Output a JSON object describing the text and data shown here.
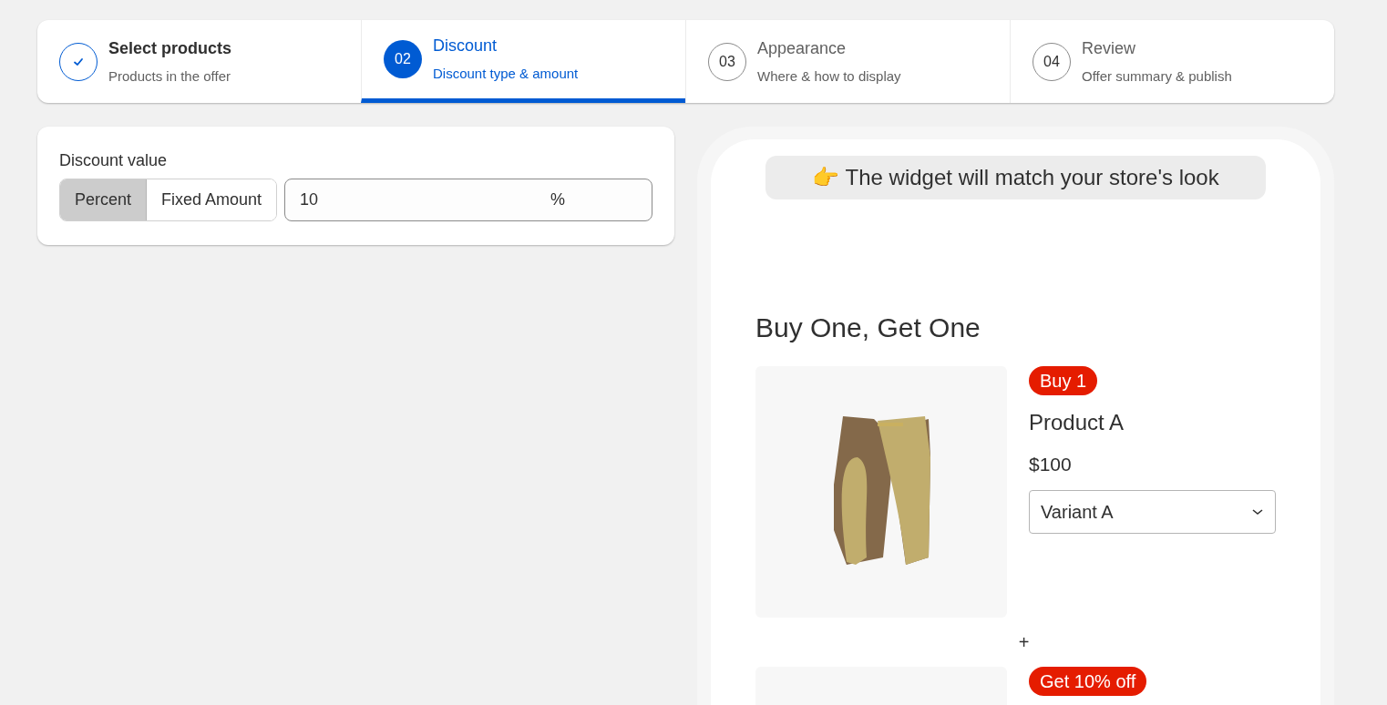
{
  "steps": [
    {
      "title": "Select products",
      "subtitle": "Products in the offer",
      "done": true,
      "selected": false
    },
    {
      "number": "02",
      "title": "Discount",
      "subtitle": "Discount type & amount",
      "done": false,
      "selected": true
    },
    {
      "number": "03",
      "title": "Appearance",
      "subtitle": "Where & how to display",
      "done": false,
      "selected": false
    },
    {
      "number": "04",
      "title": "Review",
      "subtitle": "Offer summary & publish",
      "done": false,
      "selected": false
    }
  ],
  "discount": {
    "label": "Discount value",
    "types": [
      {
        "label": "Percent",
        "selected": true
      },
      {
        "label": "Fixed Amount",
        "selected": false
      }
    ],
    "value": "10",
    "suffix": "%"
  },
  "preview": {
    "banner": "👉 The widget will match your store's look",
    "title": "Buy One, Get One",
    "separator": "+",
    "products": [
      {
        "kind": "picture",
        "badge": "Buy 1",
        "name": "Product A",
        "price": "$100",
        "variant": "Variant A"
      },
      {
        "kind": "blank",
        "badge": "Get 10% off"
      }
    ]
  }
}
